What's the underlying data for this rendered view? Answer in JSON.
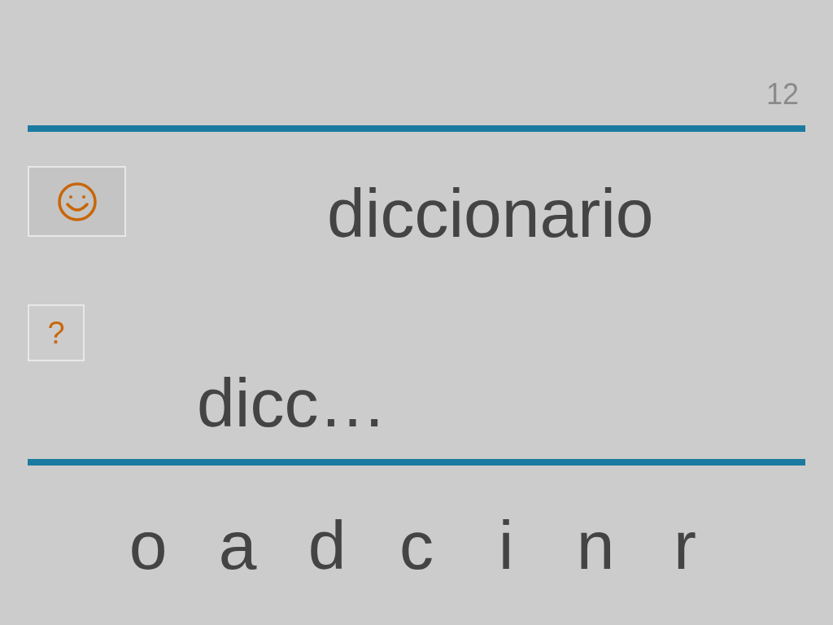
{
  "counter": "12",
  "word": "diccionario",
  "hint_button": "?",
  "answer": "dicc…",
  "letters": [
    "o",
    "a",
    "d",
    "c",
    "i",
    "n",
    "r"
  ]
}
